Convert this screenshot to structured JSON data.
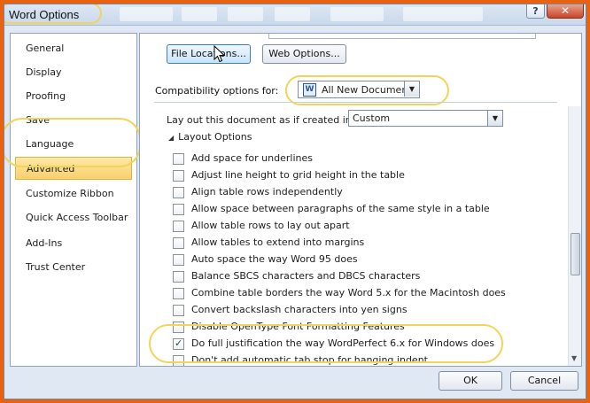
{
  "window": {
    "title": "Word Options",
    "help_label": "?",
    "close_label": "✕"
  },
  "nav": {
    "items": [
      {
        "label": "General"
      },
      {
        "label": "Display"
      },
      {
        "label": "Proofing"
      },
      {
        "label": "Save"
      },
      {
        "label": "Language"
      },
      {
        "label": "Advanced",
        "selected": true
      },
      {
        "label": "Customize Ribbon"
      },
      {
        "label": "Quick Access Toolbar"
      },
      {
        "label": "Add-Ins"
      },
      {
        "label": "Trust Center"
      }
    ]
  },
  "panel": {
    "file_locations_label": "File Locations...",
    "web_options_label": "Web Options...",
    "compat_label": "Compatibility options for:",
    "compat_value": "All New Documents",
    "doc_icon_glyph": "W",
    "layout_label": "Lay out this document as if created in:",
    "layout_value": "Custom",
    "layout_options_label": "Layout Options",
    "options": [
      {
        "label": "Add space for underlines",
        "checked": false
      },
      {
        "label": "Adjust line height to grid height in the table",
        "checked": false
      },
      {
        "label": "Align table rows independently",
        "checked": false
      },
      {
        "label": "Allow space between paragraphs of the same style in a table",
        "checked": false
      },
      {
        "label": "Allow table rows to lay out apart",
        "checked": false
      },
      {
        "label": "Allow tables to extend into margins",
        "checked": false
      },
      {
        "label": "Auto space the way Word 95 does",
        "checked": false
      },
      {
        "label": "Balance SBCS characters and DBCS characters",
        "checked": false
      },
      {
        "label": "Combine table borders the way Word 5.x for the Macintosh does",
        "checked": false
      },
      {
        "label": "Convert backslash characters into yen signs",
        "checked": false
      },
      {
        "label": "Disable OpenType Font Formatting Features",
        "checked": false
      },
      {
        "label": "Do full justification the way WordPerfect 6.x for Windows does",
        "checked": true
      },
      {
        "label": "Don't add automatic tab stop for hanging indent",
        "checked": false
      }
    ]
  },
  "footer": {
    "ok_label": "OK",
    "cancel_label": "Cancel"
  },
  "colors": {
    "frame": "#e8620f",
    "highlight_ring": "#f2d45a",
    "selected_nav": "#f9d16c"
  }
}
